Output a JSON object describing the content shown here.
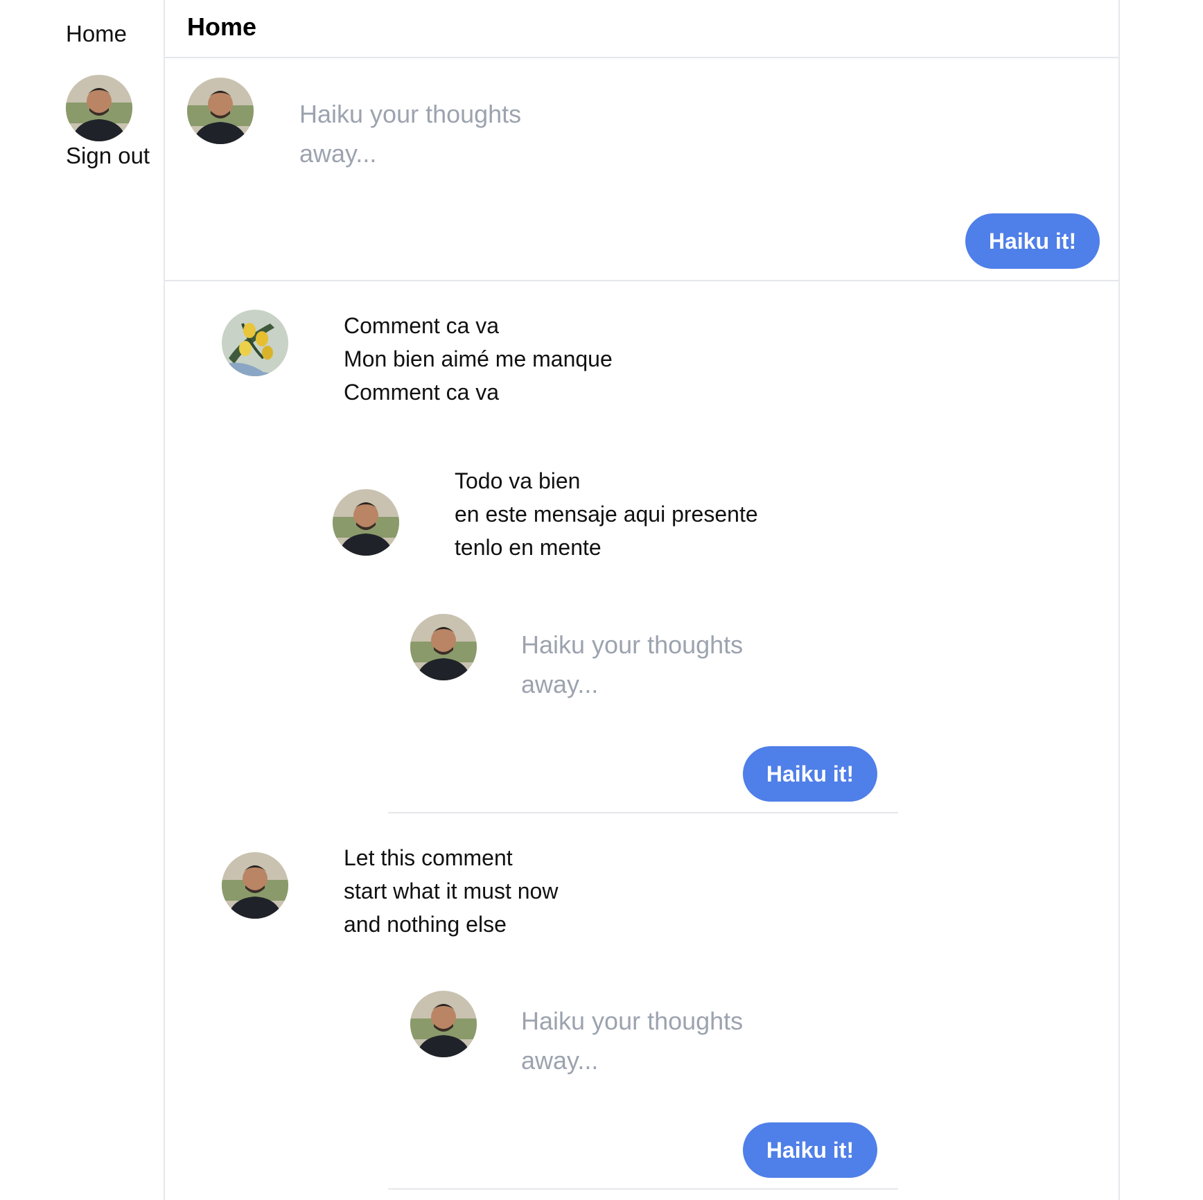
{
  "nav": {
    "home_label": "Home",
    "signout_label": "Sign out"
  },
  "header": {
    "title": "Home"
  },
  "composer": {
    "placeholder_line1": "Haiku your thoughts",
    "placeholder_line2": "away...",
    "button_label": "Haiku it!"
  },
  "feed": {
    "posts": [
      {
        "avatar": "lemon-painting-avatar",
        "lines": [
          "Comment ca va",
          "Mon bien aimé me manque",
          "Comment ca va"
        ],
        "reply": {
          "avatar": "user-avatar",
          "lines": [
            "Todo va bien",
            "en este mensaje aqui presente",
            "tenlo en mente"
          ]
        },
        "reply_composer": {
          "placeholder_line1": "Haiku your thoughts",
          "placeholder_line2": "away...",
          "button_label": "Haiku it!"
        }
      },
      {
        "avatar": "user-avatar",
        "lines": [
          "Let this comment",
          "start what it must now",
          "and nothing else"
        ],
        "reply_composer": {
          "placeholder_line1": "Haiku your thoughts",
          "placeholder_line2": "away...",
          "button_label": "Haiku it!"
        }
      }
    ]
  },
  "colors": {
    "accent": "#4f7fe8",
    "placeholder": "#9ca3af",
    "border": "#e5e7eb"
  }
}
